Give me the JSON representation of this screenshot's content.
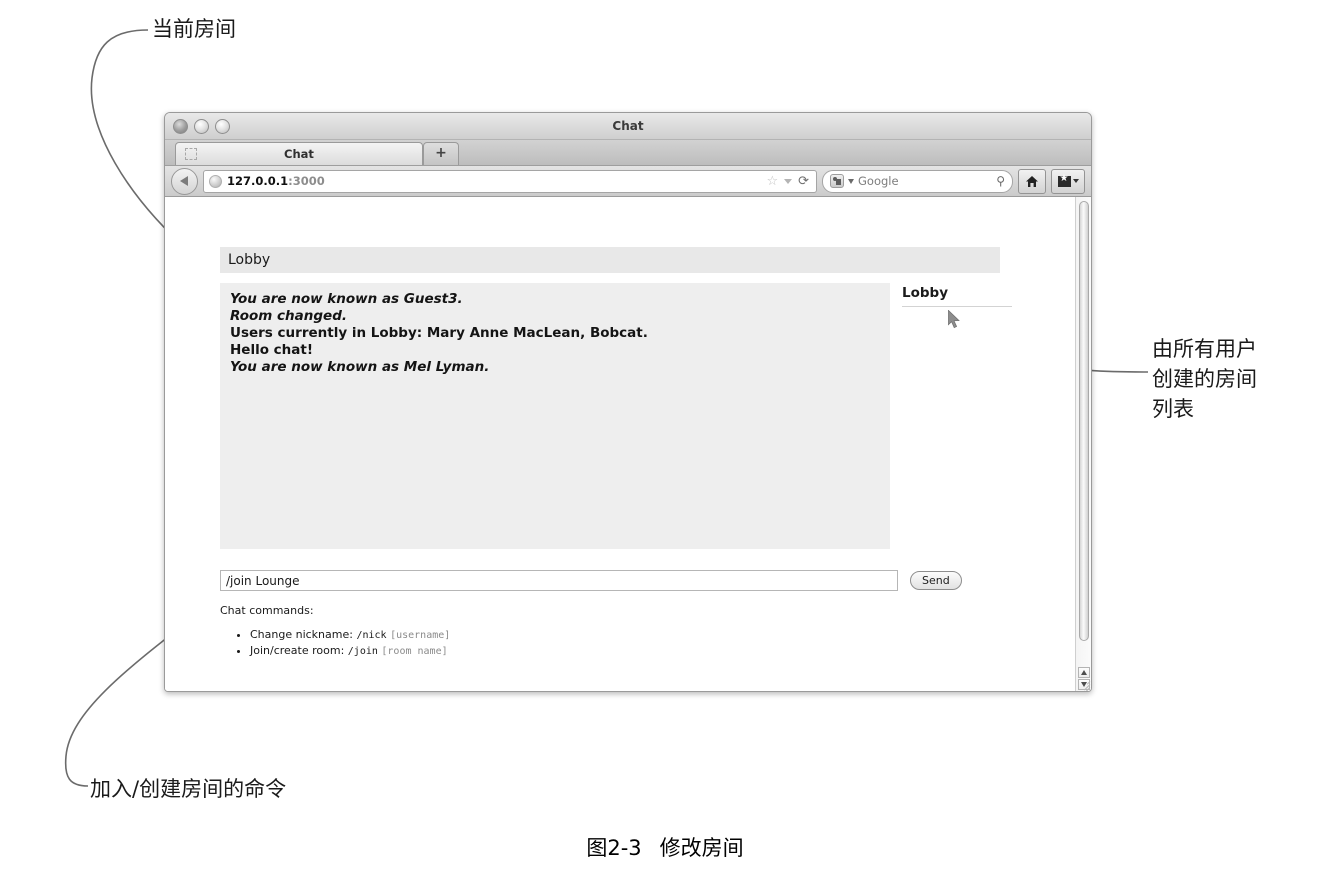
{
  "annotations": {
    "current_room": "当前房间",
    "room_list": "由所有用户\n创建的房间\n列表",
    "join_command": "加入/创建房间的命令"
  },
  "figure": {
    "number": "图2-3",
    "title": "修改房间"
  },
  "browser": {
    "window_title": "Chat",
    "traffic_lights": [
      "close-button",
      "minimize-button",
      "zoom-button"
    ],
    "tabs": [
      {
        "label": "Chat",
        "favicon": "blank-favicon",
        "active": true
      }
    ],
    "new_tab_label": "+",
    "toolbar": {
      "back_label": "back-arrow",
      "url_host": "127.0.0.1",
      "url_port": ":3000",
      "bookmark_star": "☆",
      "url_dropdown": "▾",
      "reload_glyph": "⟳",
      "search_engine": "Google",
      "search_magnifier": "🔍",
      "home_glyph": "⌂",
      "bookmarks_caret": "▾"
    }
  },
  "chat_app": {
    "room_header": "Lobby",
    "messages": [
      {
        "text": "You are now known as Guest3.",
        "style": "system"
      },
      {
        "text": "Room changed.",
        "style": "system"
      },
      {
        "text": "Users currently in Lobby: Mary Anne MacLean, Bobcat.",
        "style": "normal"
      },
      {
        "text": "Hello chat!",
        "style": "normal"
      },
      {
        "text": "You are now known as Mel Lyman.",
        "style": "system"
      }
    ],
    "room_list": [
      "Lobby"
    ],
    "input_value": "/join Lounge",
    "input_placeholder": "",
    "send_label": "Send",
    "commands_title": "Chat commands:",
    "commands": [
      {
        "label": "Change nickname: ",
        "cmd": "/nick",
        "arg": "[username]"
      },
      {
        "label": "Join/create room: ",
        "cmd": "/join",
        "arg": "[room name]"
      }
    ]
  },
  "colors": {
    "panel_bg": "#eeeeee",
    "room_header_bg": "#e8e8e8",
    "page_bg": "#ffffff",
    "text": "#141414",
    "muted": "#8b8b8b"
  },
  "scrollbar": {
    "up_arrow": "▲",
    "down_arrow": "▼"
  }
}
